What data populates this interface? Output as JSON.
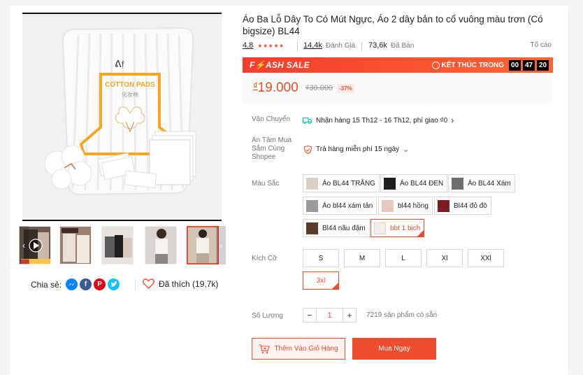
{
  "product": {
    "title": "Áo Ba Lỗ Dây To Có Mút Ngực, Áo 2 dây bản to cổ vuông màu trơn (Có bigsize) BL44",
    "rating": "4.8",
    "stars": "★★★★★",
    "reviews_count": "14,4k",
    "reviews_label": "Đánh Giá",
    "sold_count": "73,6k",
    "sold_label": "Đã Bán",
    "report": "Tố cáo"
  },
  "gallery": {
    "main_image_label": "COTTON PADS",
    "main_image_sublabel": "化妆棉",
    "prev_arrow": "‹",
    "next_arrow": "›"
  },
  "share": {
    "label": "Chia sẻ:",
    "liked": "Đã thích (19,7k)"
  },
  "flash_sale": {
    "label_prefix": "F",
    "label_rest": "ASH SALE",
    "ends_label": "KẾT THÚC TRONG",
    "hours": "00",
    "minutes": "47",
    "seconds": "20"
  },
  "price": {
    "currency": "₫",
    "current": "19.000",
    "original": "₫30.000",
    "discount": "-37%"
  },
  "shipping": {
    "label": "Vận Chuyển",
    "text": "Nhận hàng 15 Th12 - 16 Th12, phí giao ₫0",
    "chevron": "›"
  },
  "guarantee": {
    "label": "An Tâm Mua Sắm Cùng Shopee",
    "text": "Trả hàng miễn phí 15 ngày",
    "chevron": "⌄"
  },
  "colors": {
    "label": "Màu Sắc",
    "options": [
      {
        "label": "Áo BL44 TRẮNG",
        "swatch": "#d9cfc4"
      },
      {
        "label": "Áo BL44 ĐEN",
        "swatch": "#1e1e1e"
      },
      {
        "label": "Áo BL44 Xám",
        "swatch": "#6d6d6d"
      },
      {
        "label": "Áo bl44 xám tản",
        "swatch": "#9b9b9b"
      },
      {
        "label": "bl44 hồng",
        "swatch": "#e8c7c0"
      },
      {
        "label": "Bl44 đỏ đô",
        "swatch": "#7a1d22"
      },
      {
        "label": "Bl44 nâu đậm",
        "swatch": "#5a3b2c"
      },
      {
        "label": "bbt 1 bịch",
        "swatch": "#f2efe9"
      }
    ],
    "selected": "bbt 1 bịch"
  },
  "sizes": {
    "label": "Kích Cỡ",
    "options": [
      "S",
      "M",
      "L",
      "Xl",
      "XXl",
      "3xl"
    ],
    "selected": "3xl"
  },
  "quantity": {
    "label": "Số Lượng",
    "minus": "−",
    "value": "1",
    "plus": "+",
    "stock": "7219 sản phẩm có sẵn"
  },
  "actions": {
    "add_to_cart": "Thêm Vào Giỏ Hàng",
    "buy_now": "Mua Ngay"
  },
  "colors_palette": {
    "accent": "#ee4d2d"
  }
}
